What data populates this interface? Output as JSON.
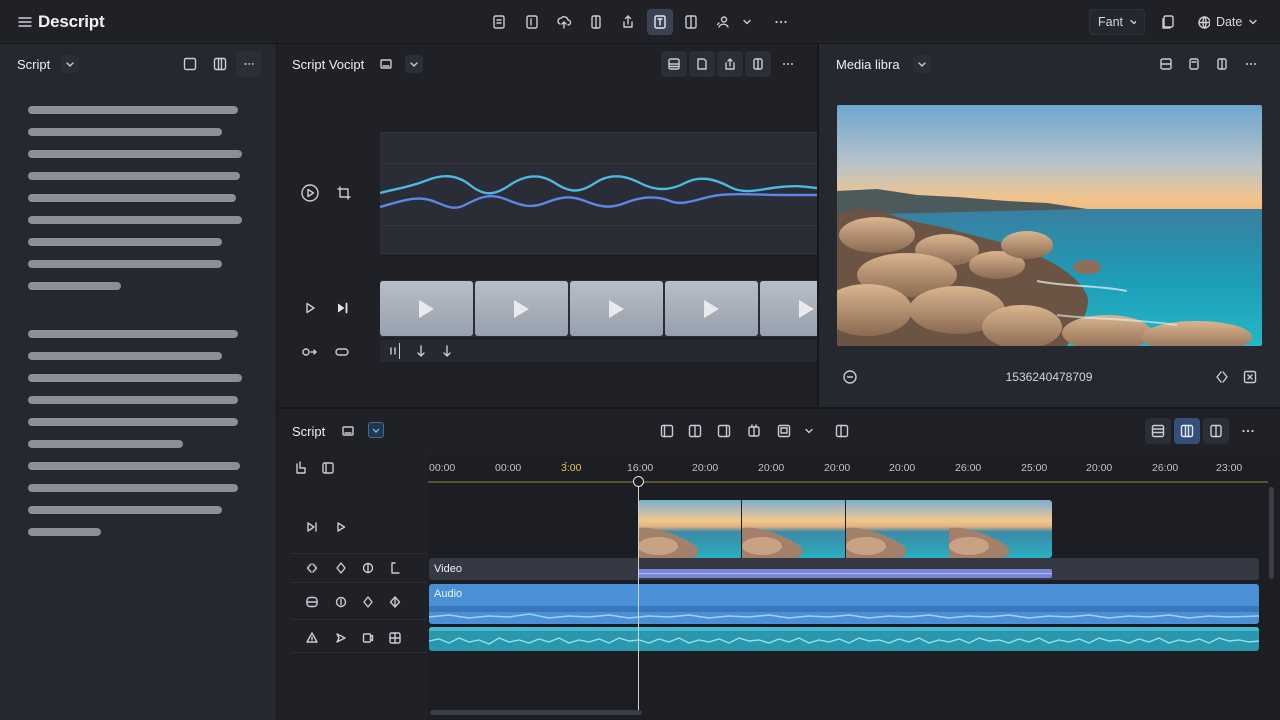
{
  "app": {
    "title": "Descript"
  },
  "topbar": {
    "font_label": "Fant",
    "date_label": "Date"
  },
  "script_panel": {
    "title": "Script"
  },
  "voice_panel": {
    "title": "Script Vocipt"
  },
  "media_panel": {
    "title": "Media libra",
    "clip_id": "1536240478709"
  },
  "timeline": {
    "title": "Script",
    "ticks": [
      "00:00",
      "00:00",
      "3́́:00",
      "16:00",
      "20:00",
      "20:00",
      "20:00",
      "20:00",
      "26:00",
      "25:00",
      "20:00",
      "26:00",
      "23:00"
    ],
    "playhead_tick_index": 2,
    "playhead_tick_color": "#e5c44a",
    "tracks": {
      "video": "Video",
      "audio": "Audio"
    }
  },
  "colors": {
    "accent": "#4a8fd8",
    "audio_track": "#4a90d6",
    "music_track": "#35a7c0",
    "waveform_a": "#4bb9e0",
    "waveform_b": "#5d86e6"
  }
}
